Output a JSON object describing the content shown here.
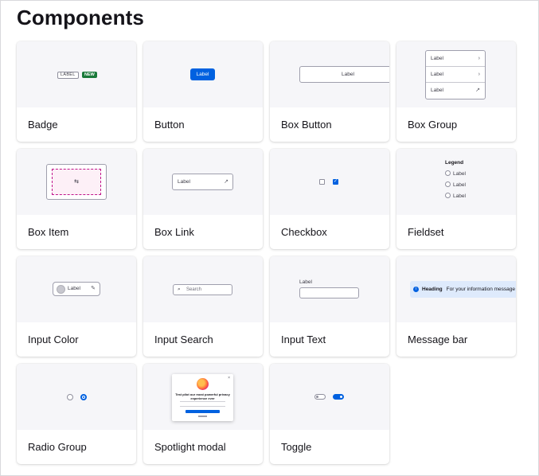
{
  "page": {
    "title": "Components"
  },
  "cards": [
    {
      "title": "Badge",
      "badge_label": "LABEL",
      "badge_new": "NEW"
    },
    {
      "title": "Button",
      "button_label": "Label"
    },
    {
      "title": "Box Button",
      "button_label": "Label"
    },
    {
      "title": "Box Group",
      "items": [
        "Label",
        "Label",
        "Label"
      ]
    },
    {
      "title": "Box Item"
    },
    {
      "title": "Box Link",
      "link_label": "Label"
    },
    {
      "title": "Checkbox"
    },
    {
      "title": "Fieldset",
      "legend": "Legend",
      "options": [
        "Label",
        "Label",
        "Label"
      ]
    },
    {
      "title": "Input Color",
      "label": "Label"
    },
    {
      "title": "Input Search",
      "placeholder": "Search"
    },
    {
      "title": "Input Text",
      "label": "Label"
    },
    {
      "title": "Message bar",
      "heading": "Heading",
      "message": "For your information message"
    },
    {
      "title": "Radio Group"
    },
    {
      "title": "Spotlight modal",
      "heading": "Test pilot our most powerful privacy experience ever"
    },
    {
      "title": "Toggle"
    }
  ],
  "icons": {
    "chevron": "chevron-right-icon",
    "external": "external-link-icon",
    "swap": "swap-icon",
    "edit": "edit-icon",
    "search": "search-icon",
    "info": "info-icon",
    "firefox": "firefox-logo-icon",
    "close": "close-icon"
  },
  "colors": {
    "accent": "#0061e0",
    "badge_new": "#1a7a3a",
    "box_item_border": "#c0158b"
  }
}
